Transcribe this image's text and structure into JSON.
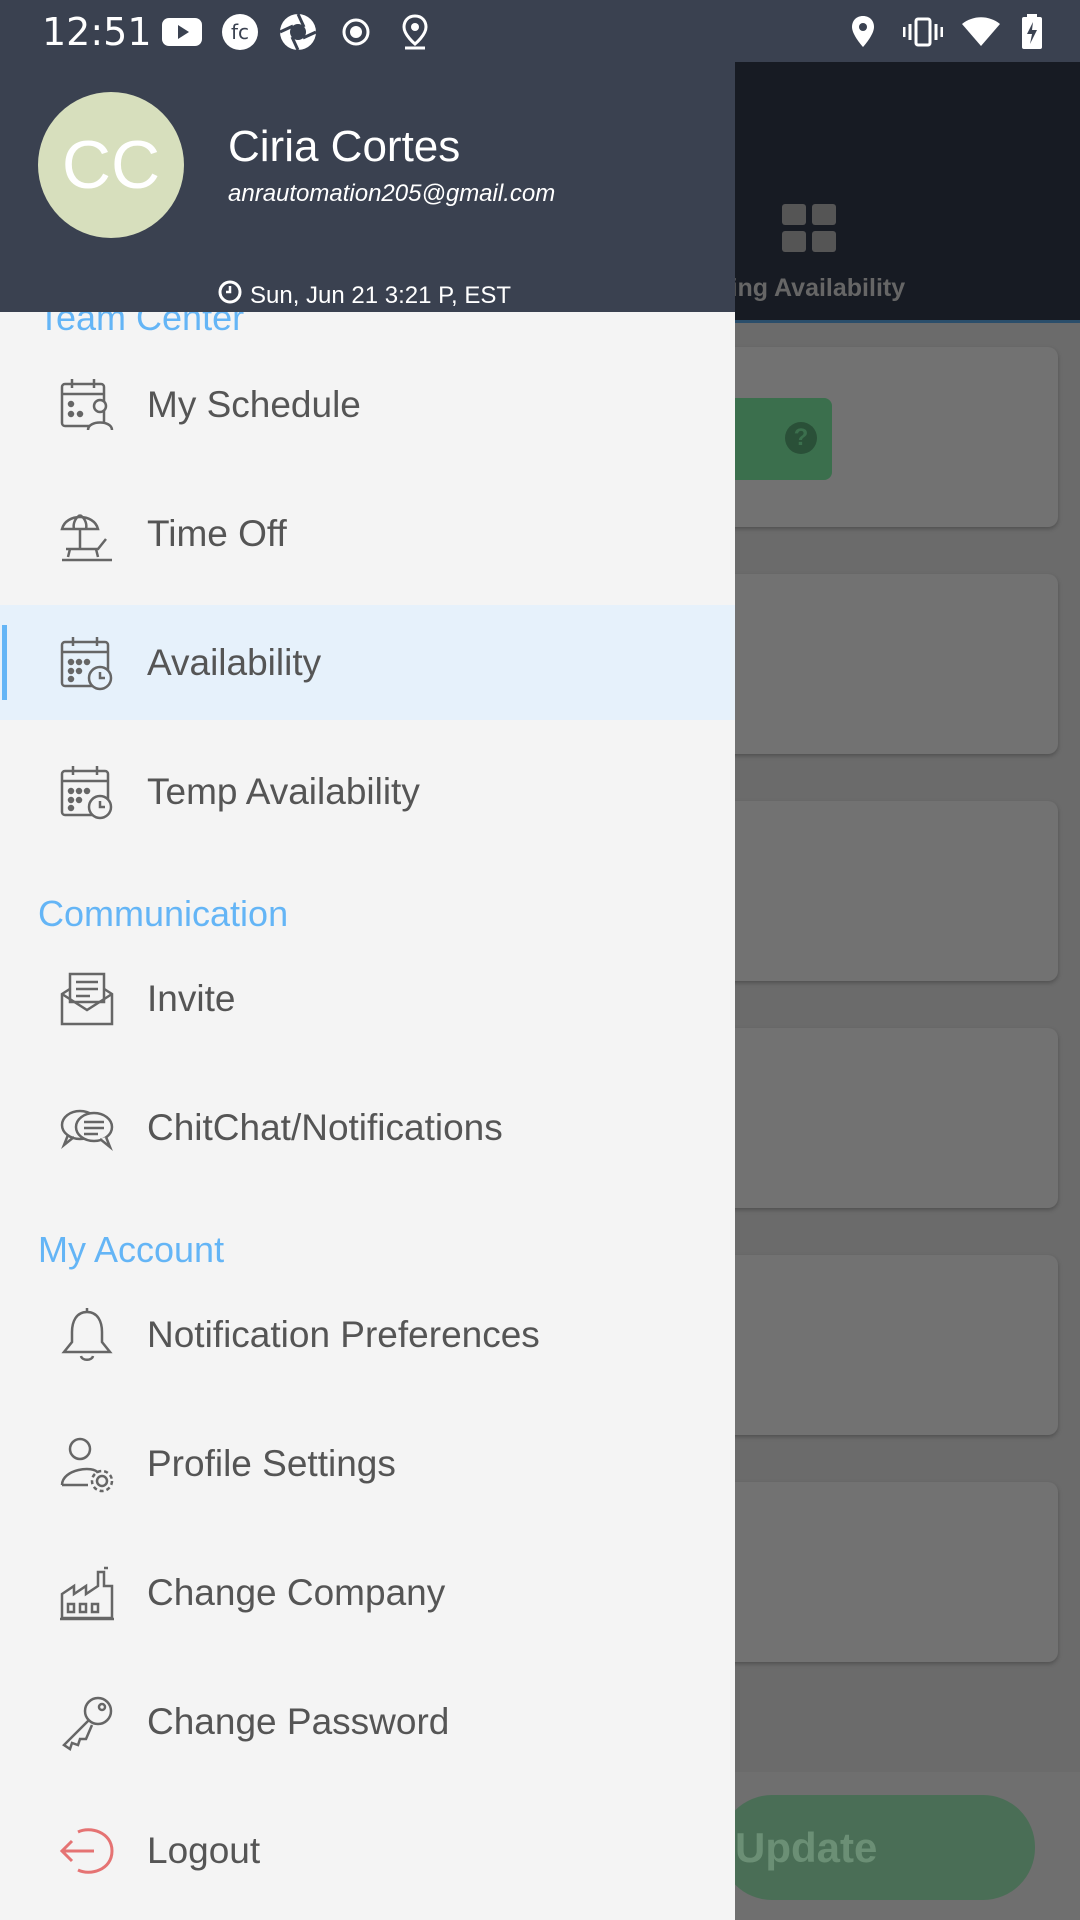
{
  "status_bar": {
    "time": "12:51"
  },
  "background": {
    "tab_label": "nding Availability",
    "update_button": "Update"
  },
  "drawer": {
    "avatar_initials": "CC",
    "user_name": "Ciria Cortes",
    "user_email": "anrautomation205@gmail.com",
    "datetime": "Sun, Jun 21 3:21 P, EST",
    "sections": {
      "team_center": "Team Center",
      "communication": "Communication",
      "my_account": "My Account"
    },
    "items": {
      "my_schedule": "My Schedule",
      "time_off": "Time Off",
      "availability": "Availability",
      "temp_availability": "Temp Availability",
      "invite": "Invite",
      "chitchat": "ChitChat/Notifications",
      "notification_preferences": "Notification Preferences",
      "profile_settings": "Profile Settings",
      "change_company": "Change Company",
      "change_password": "Change Password",
      "logout": "Logout"
    },
    "active_item": "availability"
  },
  "colors": {
    "header_bg": "#3a4150",
    "section_title": "#64b5f6",
    "active_bg": "#e6f1fb",
    "logout_icon": "#e57373"
  }
}
